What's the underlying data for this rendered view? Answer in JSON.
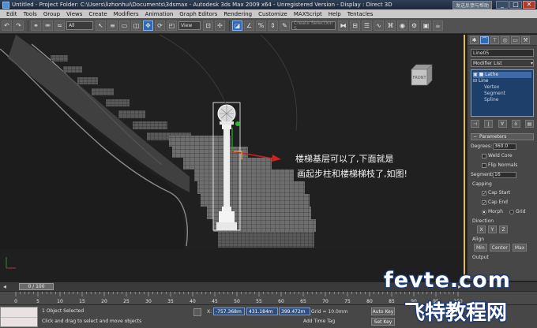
{
  "titlebar": {
    "title": "Untitled     - Project Folder: C:\\Users\\lizhonhui\\Documents\\3dsmax     - Autodesk 3ds Max  2009 x64     - Unregistered Version     - Display : Direct 3D",
    "help_badge": "发送反馈与帮助",
    "min": "_",
    "max": "□",
    "close": "✕"
  },
  "menu": [
    "Edit",
    "Tools",
    "Group",
    "Views",
    "Create",
    "Modifiers",
    "Animation",
    "Graph Editors",
    "Rendering",
    "Customize",
    "MAXScript",
    "Help",
    "Tentacles"
  ],
  "toolbar": {
    "filter": "All",
    "view": "View",
    "named_selection": "Create Selection S",
    "icons": [
      "undo-icon",
      "redo-icon",
      "link-icon",
      "unlink-icon",
      "bind-icon",
      "select-icon",
      "select-by-name-icon",
      "rect-region-icon",
      "window-crossing-icon",
      "move-icon",
      "rotate-icon",
      "scale-icon",
      "pivot-icon",
      "manipulate-icon",
      "snap-icon",
      "angle-snap-icon",
      "percent-snap-icon",
      "spinner-snap-icon",
      "mirror-icon",
      "align-icon",
      "layer-icon",
      "curve-editor-icon",
      "schematic-icon",
      "material-editor-icon",
      "render-setup-icon",
      "render-frame-icon",
      "quick-render-icon"
    ]
  },
  "viewport": {
    "label": "",
    "viewcube_label": "FRONT",
    "annotation_line1": "楼梯基层可以了,下面就是",
    "annotation_line2": "画起步柱和楼梯梯枝了,如图!"
  },
  "command_panel": {
    "object_name": "Line05",
    "modifier_list": "Modifier List",
    "stack": [
      {
        "label": "Lathe",
        "selected": true,
        "indent": false
      },
      {
        "label": "Line",
        "selected": false,
        "indent": false
      },
      {
        "label": "Vertex",
        "selected": false,
        "indent": true
      },
      {
        "label": "Segment",
        "selected": false,
        "indent": true
      },
      {
        "label": "Spline",
        "selected": false,
        "indent": true
      }
    ],
    "parameters_title": "Parameters",
    "degrees_label": "Degrees:",
    "degrees_value": "360.0",
    "weld_core": "Weld Core",
    "flip_normals": "Flip Normals",
    "segments_label": "Segments:",
    "segments_value": "16",
    "capping_label": "Capping",
    "cap_start": "Cap Start",
    "cap_end": "Cap End",
    "morph": "Morph",
    "grid": "Grid",
    "direction_label": "Direction",
    "dir_x": "X",
    "dir_y": "Y",
    "dir_z": "Z",
    "align_label": "Align",
    "align_min": "Min",
    "align_center": "Center",
    "align_max": "Max",
    "output_label": "Output"
  },
  "timeline": {
    "frame": "0 / 100",
    "ticks": [
      "0",
      "5",
      "10",
      "15",
      "20",
      "25",
      "30",
      "35",
      "40",
      "45",
      "50",
      "55",
      "60",
      "65",
      "70",
      "75",
      "80",
      "85",
      "90",
      "95",
      "100"
    ]
  },
  "status": {
    "selection": "1 Object Selected",
    "prompt": "Click and drag to select and move objects",
    "x_label": "X:",
    "x_value": "-757.368m",
    "y_label": "Y:",
    "y_value": "431.184m",
    "z_label": "Z:",
    "z_value": "399.472m",
    "grid": "Grid = 10.0mm",
    "add_time_tag": "Add Time Tag",
    "auto_key": "Auto Key",
    "set_key": "Set Key"
  },
  "watermark": {
    "top": "fevte.com",
    "bottom": "飞特教程网"
  }
}
